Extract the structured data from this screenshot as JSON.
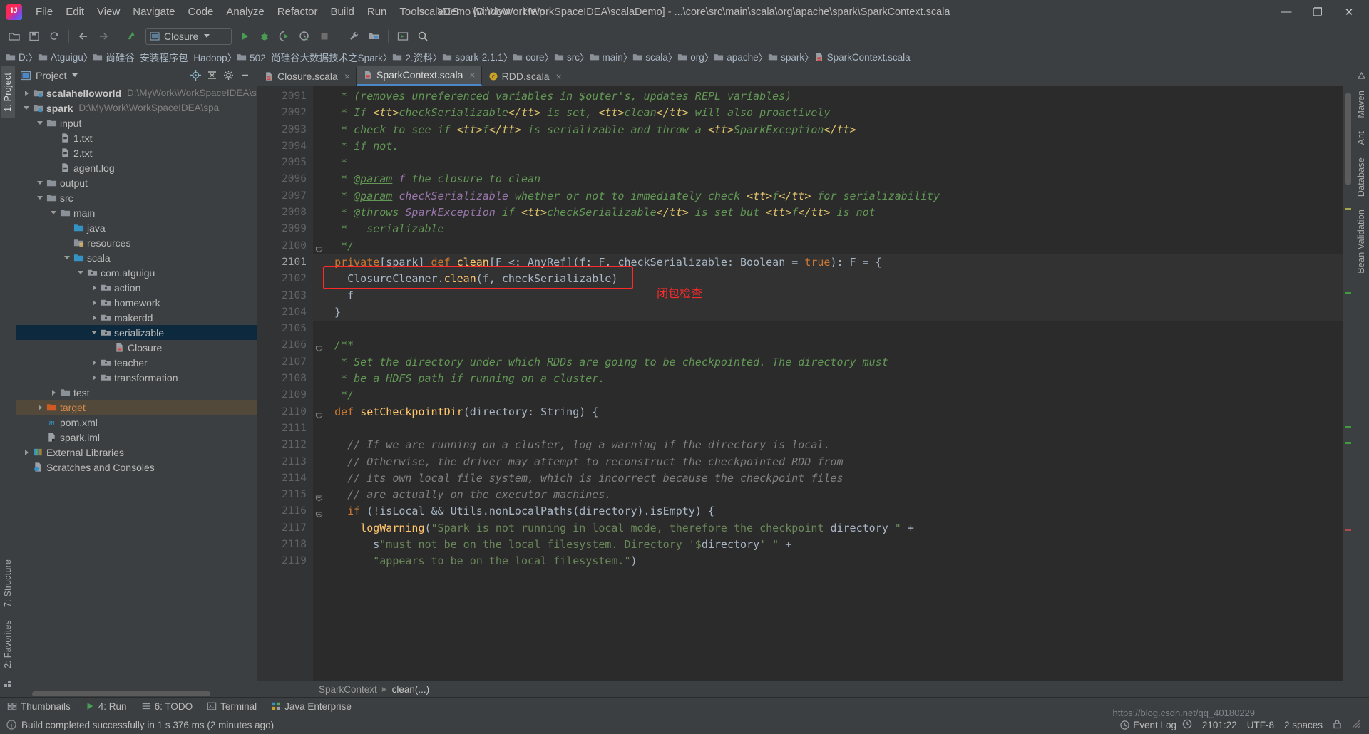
{
  "window": {
    "title": "scalaDemo [D:\\MyWork\\WorkSpaceIDEA\\scalaDemo] - ...\\core\\src\\main\\scala\\org\\apache\\spark\\SparkContext.scala",
    "minimize": "—",
    "maximize": "❐",
    "close": "✕"
  },
  "menu": [
    "File",
    "Edit",
    "View",
    "Navigate",
    "Code",
    "Analyze",
    "Refactor",
    "Build",
    "Run",
    "Tools",
    "VCS",
    "Window",
    "Help"
  ],
  "toolbar": {
    "run_config": "Closure",
    "icons": [
      "open-folder-icon",
      "save-all-icon",
      "sync-icon",
      "back-arrow-icon",
      "forward-arrow-icon",
      "update-project-icon",
      "run-icon",
      "debug-icon",
      "run-coverage-icon",
      "profile-icon",
      "stop-icon",
      "settings-wrench-icon",
      "project-structure-icon",
      "run-anything-icon",
      "search-everywhere-icon"
    ]
  },
  "breadcrumb": [
    "D:",
    "Atguigu",
    "尚硅谷_安装程序包_Hadoop",
    "502_尚硅谷大数据技术之Spark",
    "2.资料",
    "spark-2.1.1",
    "core",
    "src",
    "main",
    "scala",
    "org",
    "apache",
    "spark",
    "SparkContext.scala"
  ],
  "left_strips": [
    "1: Project",
    "7: Structure",
    "2: Favorites"
  ],
  "right_strips": [
    "Maven",
    "Ant",
    "Database",
    "Bean Validation"
  ],
  "project_panel": {
    "title": "Project",
    "actions": [
      "locate-icon",
      "collapse-all-icon",
      "settings-gear-icon",
      "hide-icon"
    ],
    "tree": [
      {
        "indent": 0,
        "arrow": "right",
        "icon": "module-icon",
        "label": "scalahelloworld",
        "bold": true,
        "path": "D:\\MyWork\\WorkSpaceIDEA\\scal",
        "state": "none"
      },
      {
        "indent": 0,
        "arrow": "down",
        "icon": "module-icon",
        "label": "spark",
        "bold": true,
        "path": "D:\\MyWork\\WorkSpaceIDEA\\spa",
        "state": "none"
      },
      {
        "indent": 1,
        "arrow": "down",
        "icon": "folder-icon",
        "label": "input",
        "bold": false,
        "path": "",
        "state": "none"
      },
      {
        "indent": 2,
        "arrow": "none",
        "icon": "file-icon",
        "label": "1.txt",
        "bold": false,
        "path": "",
        "state": "none"
      },
      {
        "indent": 2,
        "arrow": "none",
        "icon": "file-icon",
        "label": "2.txt",
        "bold": false,
        "path": "",
        "state": "none"
      },
      {
        "indent": 2,
        "arrow": "none",
        "icon": "file-icon",
        "label": "agent.log",
        "bold": false,
        "path": "",
        "state": "none"
      },
      {
        "indent": 1,
        "arrow": "down",
        "icon": "folder-icon",
        "label": "output",
        "bold": false,
        "path": "",
        "state": "none"
      },
      {
        "indent": 1,
        "arrow": "down",
        "icon": "folder-icon",
        "label": "src",
        "bold": false,
        "path": "",
        "state": "none"
      },
      {
        "indent": 2,
        "arrow": "down",
        "icon": "folder-icon",
        "label": "main",
        "bold": false,
        "path": "",
        "state": "none"
      },
      {
        "indent": 3,
        "arrow": "none",
        "icon": "source-root-icon",
        "label": "java",
        "bold": false,
        "path": "",
        "state": "none"
      },
      {
        "indent": 3,
        "arrow": "none",
        "icon": "resource-root-icon",
        "label": "resources",
        "bold": false,
        "path": "",
        "state": "none"
      },
      {
        "indent": 3,
        "arrow": "down",
        "icon": "source-root-icon",
        "label": "scala",
        "bold": false,
        "path": "",
        "state": "none"
      },
      {
        "indent": 4,
        "arrow": "down",
        "icon": "package-icon",
        "label": "com.atguigu",
        "bold": false,
        "path": "",
        "state": "none"
      },
      {
        "indent": 5,
        "arrow": "right",
        "icon": "package-icon",
        "label": "action",
        "bold": false,
        "path": "",
        "state": "none"
      },
      {
        "indent": 5,
        "arrow": "right",
        "icon": "package-icon",
        "label": "homework",
        "bold": false,
        "path": "",
        "state": "none"
      },
      {
        "indent": 5,
        "arrow": "right",
        "icon": "package-icon",
        "label": "makerdd",
        "bold": false,
        "path": "",
        "state": "none"
      },
      {
        "indent": 5,
        "arrow": "down",
        "icon": "package-icon",
        "label": "serializable",
        "bold": false,
        "path": "",
        "state": "selected"
      },
      {
        "indent": 6,
        "arrow": "none",
        "icon": "scala-file-icon",
        "label": "Closure",
        "bold": false,
        "path": "",
        "state": "none"
      },
      {
        "indent": 5,
        "arrow": "right",
        "icon": "package-icon",
        "label": "teacher",
        "bold": false,
        "path": "",
        "state": "none"
      },
      {
        "indent": 5,
        "arrow": "right",
        "icon": "package-icon",
        "label": "transformation",
        "bold": false,
        "path": "",
        "state": "none"
      },
      {
        "indent": 2,
        "arrow": "right",
        "icon": "folder-icon",
        "label": "test",
        "bold": false,
        "path": "",
        "state": "none"
      },
      {
        "indent": 1,
        "arrow": "right",
        "icon": "target-folder-icon",
        "label": "target",
        "bold": false,
        "path": "",
        "state": "amber"
      },
      {
        "indent": 1,
        "arrow": "none",
        "icon": "maven-icon",
        "label": "pom.xml",
        "bold": false,
        "path": "",
        "state": "none"
      },
      {
        "indent": 1,
        "arrow": "none",
        "icon": "iml-icon",
        "label": "spark.iml",
        "bold": false,
        "path": "",
        "state": "none"
      },
      {
        "indent": 0,
        "arrow": "right",
        "icon": "libraries-icon",
        "label": "External Libraries",
        "bold": false,
        "path": "",
        "state": "none"
      },
      {
        "indent": 0,
        "arrow": "none",
        "icon": "scratches-icon",
        "label": "Scratches and Consoles",
        "bold": false,
        "path": "",
        "state": "none"
      }
    ]
  },
  "editor": {
    "tabs": [
      {
        "label": "Closure.scala",
        "icon": "scala-file-icon",
        "active": false
      },
      {
        "label": "SparkContext.scala",
        "icon": "scala-file-icon",
        "active": true
      },
      {
        "label": "RDD.scala",
        "icon": "scala-class-icon",
        "active": false
      }
    ],
    "first_line_number": 2091,
    "lines": [
      {
        "n": 2091,
        "text": "   * (removes unreferenced variables in $outer's, updates REPL variables)"
      },
      {
        "n": 2092,
        "text": "   * If <tt>checkSerializable</tt> is set, <tt>clean</tt> will also proactively"
      },
      {
        "n": 2093,
        "text": "   * check to see if <tt>f</tt> is serializable and throw a <tt>SparkException</tt>"
      },
      {
        "n": 2094,
        "text": "   * if not."
      },
      {
        "n": 2095,
        "text": "   *"
      },
      {
        "n": 2096,
        "text": "   * @param f the closure to clean"
      },
      {
        "n": 2097,
        "text": "   * @param checkSerializable whether or not to immediately check <tt>f</tt> for serializability"
      },
      {
        "n": 2098,
        "text": "   * @throws SparkException if <tt>checkSerializable</tt> is set but <tt>f</tt> is not"
      },
      {
        "n": 2099,
        "text": "   *   serializable"
      },
      {
        "n": 2100,
        "text": "   */"
      },
      {
        "n": 2101,
        "text": "  private[spark] def clean[F <: AnyRef](f: F, checkSerializable: Boolean = true): F = {"
      },
      {
        "n": 2102,
        "text": "    ClosureCleaner.clean(f, checkSerializable)"
      },
      {
        "n": 2103,
        "text": "    f"
      },
      {
        "n": 2104,
        "text": "  }"
      },
      {
        "n": 2105,
        "text": ""
      },
      {
        "n": 2106,
        "text": "  /**"
      },
      {
        "n": 2107,
        "text": "   * Set the directory under which RDDs are going to be checkpointed. The directory must"
      },
      {
        "n": 2108,
        "text": "   * be a HDFS path if running on a cluster."
      },
      {
        "n": 2109,
        "text": "   */"
      },
      {
        "n": 2110,
        "text": "  def setCheckpointDir(directory: String) {"
      },
      {
        "n": 2111,
        "text": ""
      },
      {
        "n": 2112,
        "text": "    // If we are running on a cluster, log a warning if the directory is local."
      },
      {
        "n": 2113,
        "text": "    // Otherwise, the driver may attempt to reconstruct the checkpointed RDD from"
      },
      {
        "n": 2114,
        "text": "    // its own local file system, which is incorrect because the checkpoint files"
      },
      {
        "n": 2115,
        "text": "    // are actually on the executor machines."
      },
      {
        "n": 2116,
        "text": "    if (!isLocal && Utils.nonLocalPaths(directory).isEmpty) {"
      },
      {
        "n": 2117,
        "text": "      logWarning(\"Spark is not running in local mode, therefore the checkpoint directory \" +"
      },
      {
        "n": 2118,
        "text": "        s\"must not be on the local filesystem. Directory '$directory' \" +"
      },
      {
        "n": 2119,
        "text": "        \"appears to be on the local filesystem.\")"
      }
    ],
    "annotation_cn": "闭包检查",
    "crumb_class": "SparkContext",
    "crumb_method": "clean(...)"
  },
  "bottom_tools": [
    {
      "label": "Thumbnails",
      "icon": "thumbnails-icon"
    },
    {
      "label": "4: Run",
      "icon": "run-icon"
    },
    {
      "label": "6: TODO",
      "icon": "todo-icon"
    },
    {
      "label": "Terminal",
      "icon": "terminal-icon"
    },
    {
      "label": "Java Enterprise",
      "icon": "java-enterprise-icon"
    }
  ],
  "status": {
    "message": "Build completed successfully in 1 s 376 ms (2 minutes ago)",
    "caret": "2101:22",
    "encoding": "UTF-8",
    "indent": "2 spaces",
    "event_log": "Event Log",
    "watermark": "https://blog.csdn.net/qq_40180229"
  },
  "colors": {
    "accent_blue": "#4a88c7",
    "annotation_red": "#ff2a2a",
    "selection_blue": "#0d293e",
    "target_amber": "#53493a",
    "editor_bg": "#2b2b2b",
    "panel_bg": "#3c3f41"
  }
}
